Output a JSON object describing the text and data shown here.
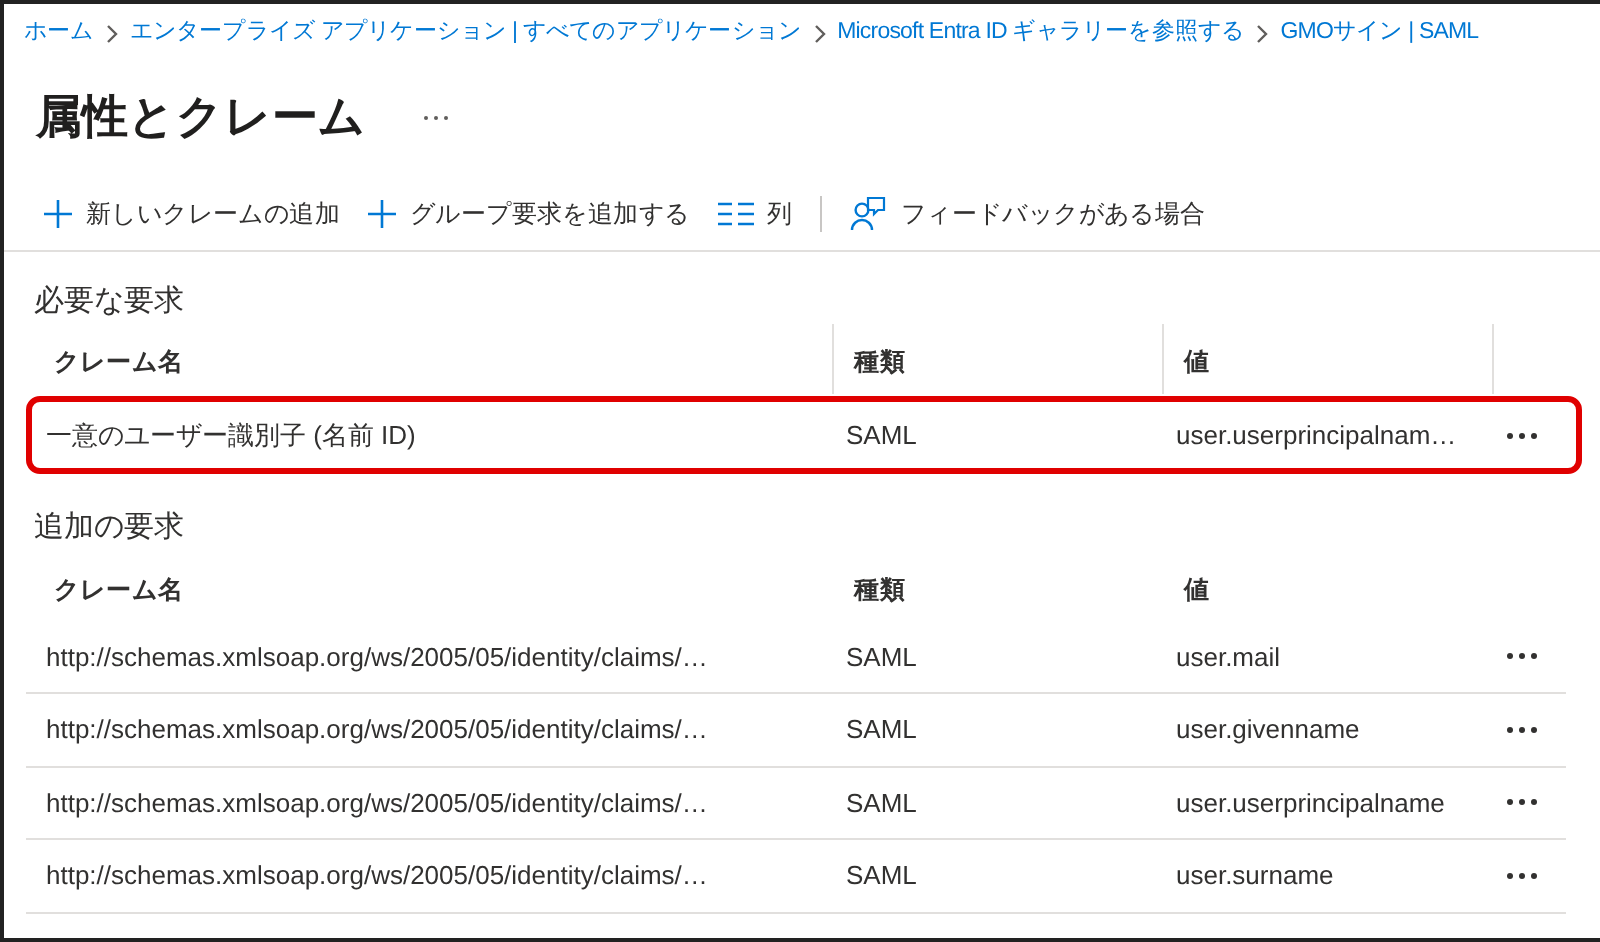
{
  "breadcrumb": [
    "ホーム",
    "エンタープライズ アプリケーション | すべてのアプリケーション",
    "Microsoft Entra ID ギャラリーを参照する",
    "GMOサイン | SAML"
  ],
  "title": "属性とクレーム",
  "toolbar": [
    {
      "kind": "add",
      "label": "新しいクレームの追加"
    },
    {
      "kind": "add",
      "label": "グループ要求を追加する"
    },
    {
      "kind": "columns",
      "label": "列"
    },
    {
      "kind": "feedback",
      "label": "フィードバックがある場合"
    }
  ],
  "sections": [
    {
      "heading": "必要な要求",
      "columns": [
        "クレーム名",
        "種類",
        "値"
      ],
      "rows": [
        {
          "name": "一意のユーザー識別子 (名前 ID)",
          "type": "SAML",
          "value": "user.userprincipalnam…",
          "highlighted": true
        }
      ]
    },
    {
      "heading": "追加の要求",
      "columns": [
        "クレーム名",
        "種類",
        "値"
      ],
      "rows": [
        {
          "name": "http://schemas.xmlsoap.org/ws/2005/05/identity/claims/…",
          "type": "SAML",
          "value": "user.mail",
          "highlighted": false
        },
        {
          "name": "http://schemas.xmlsoap.org/ws/2005/05/identity/claims/…",
          "type": "SAML",
          "value": "user.givenname",
          "highlighted": false
        },
        {
          "name": "http://schemas.xmlsoap.org/ws/2005/05/identity/claims/…",
          "type": "SAML",
          "value": "user.userprincipalname",
          "highlighted": false
        },
        {
          "name": "http://schemas.xmlsoap.org/ws/2005/05/identity/claims/…",
          "type": "SAML",
          "value": "user.surname",
          "highlighted": false
        }
      ]
    }
  ]
}
